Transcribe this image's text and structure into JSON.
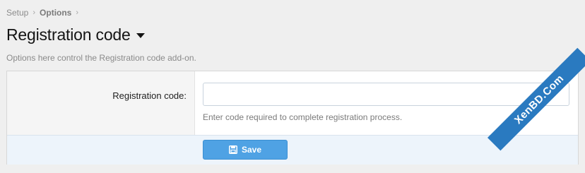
{
  "breadcrumb": {
    "items": [
      "Setup",
      "Options"
    ],
    "separator": "›"
  },
  "header": {
    "title": "Registration code",
    "description": "Options here control the Registration code add-on."
  },
  "form": {
    "field": {
      "label": "Registration code:",
      "value": "",
      "placeholder": "",
      "hint": "Enter code required to complete registration process."
    },
    "save_label": "Save"
  },
  "watermark": "XenBD.Com",
  "colors": {
    "accent": "#4fa2e4",
    "submit_row": "#edf4fb",
    "page_background": "#efefef"
  },
  "icons": {
    "title_dropdown": "caret-down-icon",
    "save": "floppy-disk-icon"
  }
}
